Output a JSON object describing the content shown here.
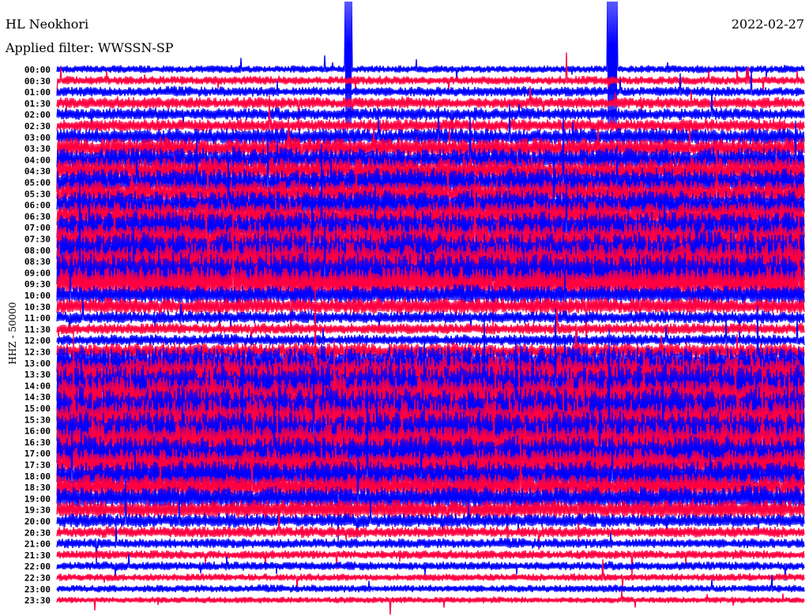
{
  "header": {
    "station": "HL Neokhori",
    "filter": "Applied filter: WWSSN-SP",
    "date": "2022-02-27"
  },
  "chart_data": {
    "type": "line",
    "title": "HL Neokhori",
    "subtitle": "Applied filter: WWSSN-SP",
    "ylabel": "HHZ - 50000",
    "xlabel": "",
    "colors": [
      "#0000ff",
      "#ff0040"
    ],
    "row_labels": [
      "00:00",
      "00:30",
      "01:00",
      "01:30",
      "02:00",
      "02:30",
      "03:00",
      "03:30",
      "04:00",
      "04:30",
      "05:00",
      "05:30",
      "06:00",
      "06:30",
      "07:00",
      "07:30",
      "08:00",
      "08:30",
      "09:00",
      "09:30",
      "10:00",
      "10:30",
      "11:00",
      "11:30",
      "12:00",
      "12:30",
      "13:00",
      "13:30",
      "14:00",
      "14:30",
      "15:00",
      "15:30",
      "16:00",
      "16:30",
      "17:00",
      "17:30",
      "18:00",
      "18:30",
      "19:00",
      "19:30",
      "20:00",
      "20:30",
      "21:00",
      "21:30",
      "22:00",
      "22:30",
      "23:00",
      "23:30"
    ],
    "relative_amplitude": [
      0.6,
      0.7,
      0.8,
      0.9,
      1.0,
      1.0,
      1.3,
      1.6,
      1.8,
      2.0,
      2.0,
      2.0,
      2.2,
      2.2,
      2.3,
      2.4,
      2.6,
      2.8,
      2.8,
      2.6,
      1.5,
      1.3,
      1.0,
      0.9,
      0.9,
      1.3,
      2.4,
      2.8,
      3.0,
      3.0,
      3.0,
      3.0,
      2.8,
      2.8,
      2.6,
      2.4,
      2.2,
      2.0,
      1.8,
      1.5,
      1.1,
      0.9,
      0.8,
      0.7,
      0.7,
      0.6,
      0.6,
      0.5
    ]
  }
}
